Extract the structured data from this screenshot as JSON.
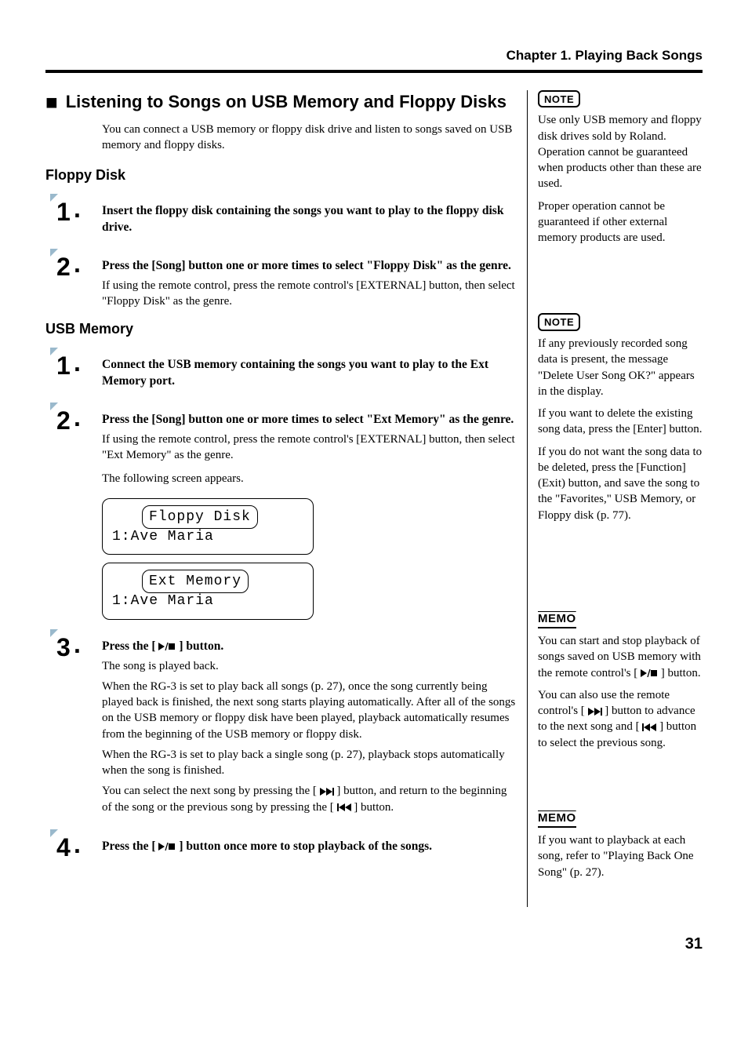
{
  "chapter_head": "Chapter 1. Playing Back Songs",
  "h1": "Listening to Songs on USB Memory and Floppy Disks",
  "intro": "You can connect a USB memory or floppy disk drive and listen to songs saved on USB memory and floppy disks.",
  "sections": {
    "floppy": {
      "title": "Floppy Disk",
      "steps": [
        {
          "num": "1",
          "title": "Insert the floppy disk containing the songs you want to play to the floppy disk drive."
        },
        {
          "num": "2",
          "title": "Press the [Song] button one or more times to select \"Floppy Disk\" as the genre.",
          "text": "If using the remote control, press the remote control's [EXTERNAL] button, then select \"Floppy Disk\" as the genre."
        }
      ]
    },
    "usb": {
      "title": "USB Memory",
      "steps": [
        {
          "num": "1",
          "title": "Connect the USB memory containing the songs you want to play to the Ext Memory port."
        },
        {
          "num": "2",
          "title": "Press the [Song] button one or more times to select \"Ext Memory\" as the genre.",
          "text1": "If using the remote control, press the remote control's [EXTERNAL] button, then select \"Ext Memory\" as the genre.",
          "text2": "The following screen appears."
        }
      ]
    }
  },
  "lcd": {
    "floppy": {
      "title": "Floppy Disk",
      "line": "1:Ave Maria"
    },
    "ext": {
      "title": "Ext Memory",
      "line": "1:Ave Maria"
    }
  },
  "step3": {
    "num": "3",
    "title_pre": "Press the [ ",
    "title_post": " ] button.",
    "p1": "The song is played back.",
    "p2": "When the RG-3 is set to play back all songs (p. 27), once the song currently being played back is finished, the next song starts playing automatically. After all of the songs on the USB memory or floppy disk have been played, playback automatically resumes from the beginning of the USB memory or floppy disk.",
    "p3": "When the RG-3 is set to play back a single song (p. 27), playback stops automatically when the song is finished.",
    "p4_a": "You can select the next song by pressing the [ ",
    "p4_b": " ] button, and return to the beginning of the song or the previous song by pressing the [ ",
    "p4_c": " ] button."
  },
  "step4": {
    "num": "4",
    "title_pre": "Press the [ ",
    "title_post": " ] button once more to stop playback of the songs."
  },
  "side": {
    "note1": {
      "label": "NOTE",
      "p1": "Use only USB memory and floppy disk drives sold by Roland. Operation cannot be guaranteed when products other than these are used.",
      "p2": "Proper operation cannot be guaranteed if other external memory products are used."
    },
    "note2": {
      "label": "NOTE",
      "p1": "If any previously recorded song data is present, the message \"Delete User Song OK?\" appears in the display.",
      "p2": "If you want to delete the existing song data, press the [Enter] button.",
      "p3": "If you do not want the song data to be deleted, press the [Function] (Exit) button, and save the song to the \"Favorites,\" USB Memory, or Floppy disk (p. 77)."
    },
    "memo1": {
      "label": "MEMO",
      "p1_a": "You can start and stop playback of songs saved on USB memory with the remote control's [ ",
      "p1_b": " ] button.",
      "p2_a": "You can also use the remote control's [ ",
      "p2_b": " ] button to advance to the next song and [ ",
      "p2_c": " ] button to select the previous song."
    },
    "memo2": {
      "label": "MEMO",
      "p1": "If you want to playback at each song, refer to \"Playing Back One Song\" (p. 27)."
    }
  },
  "page_num": "31"
}
